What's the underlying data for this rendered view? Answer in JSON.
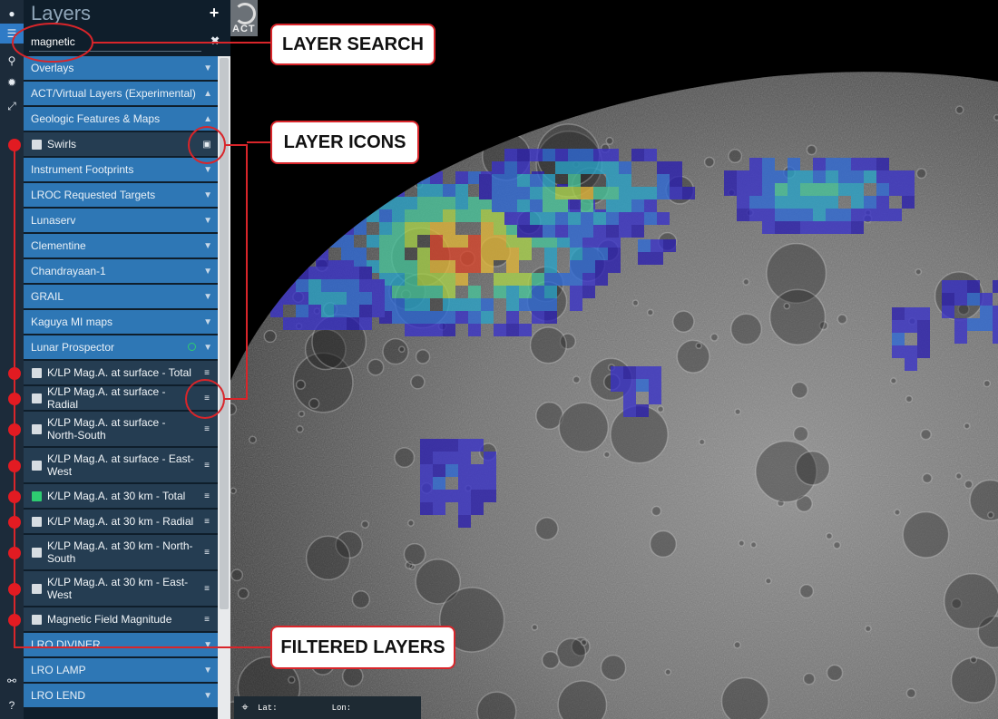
{
  "toolbar": {
    "tools": [
      {
        "name": "globe-icon",
        "glyph": "●",
        "active": false
      },
      {
        "name": "layers-menu-icon",
        "glyph": "☰",
        "active": true
      },
      {
        "name": "zoom-search-icon",
        "glyph": "⚲",
        "active": false
      },
      {
        "name": "settings-gear-icon",
        "glyph": "✹",
        "active": false
      },
      {
        "name": "expand-icon",
        "glyph": "⤢",
        "active": false
      },
      {
        "name": "link-icon",
        "glyph": "⚯",
        "active": false
      },
      {
        "name": "help-icon",
        "glyph": "?",
        "active": false
      }
    ]
  },
  "panel": {
    "title": "Layers",
    "add_glyph": "+",
    "search": {
      "value": "magnetic",
      "clear_glyph": "✖"
    }
  },
  "layers": [
    {
      "kind": "group",
      "label": "Overlays"
    },
    {
      "kind": "group",
      "label": "ACT/Virtual Layers (Experimental)",
      "open": true
    },
    {
      "kind": "group",
      "label": "Geologic Features & Maps",
      "open": true
    },
    {
      "kind": "layer",
      "label": "Swirls",
      "checked": false,
      "icon": "image-icon",
      "marked": true
    },
    {
      "kind": "group",
      "label": "Instrument Footprints"
    },
    {
      "kind": "group",
      "label": "LROC Requested Targets"
    },
    {
      "kind": "group",
      "label": "Lunaserv"
    },
    {
      "kind": "group",
      "label": "Clementine"
    },
    {
      "kind": "group",
      "label": "Chandrayaan-1"
    },
    {
      "kind": "group",
      "label": "GRAIL"
    },
    {
      "kind": "group",
      "label": "Kaguya MI maps"
    },
    {
      "kind": "group",
      "label": "Lunar Prospector",
      "loading": true
    },
    {
      "kind": "layer",
      "label": "K/LP Mag.A. at surface - Total",
      "checked": false,
      "icon": "sliders-icon",
      "marked": true
    },
    {
      "kind": "layer",
      "label": "K/LP Mag.A. at surface - Radial",
      "checked": false,
      "icon": "sliders-icon",
      "marked": true
    },
    {
      "kind": "layer",
      "label": "K/LP Mag.A. at surface - North-South",
      "checked": false,
      "icon": "sliders-icon",
      "marked": true,
      "tall": true
    },
    {
      "kind": "layer",
      "label": "K/LP Mag.A. at surface - East-West",
      "checked": false,
      "icon": "sliders-icon",
      "marked": true,
      "tall": true
    },
    {
      "kind": "layer",
      "label": "K/LP Mag.A. at 30 km - Total",
      "checked": true,
      "icon": "sliders-icon",
      "marked": true
    },
    {
      "kind": "layer",
      "label": "K/LP Mag.A. at 30 km - Radial",
      "checked": false,
      "icon": "sliders-icon",
      "marked": true
    },
    {
      "kind": "layer",
      "label": "K/LP Mag.A. at 30 km - North-South",
      "checked": false,
      "icon": "sliders-icon",
      "marked": true,
      "tall": true
    },
    {
      "kind": "layer",
      "label": "K/LP Mag.A. at 30 km - East-West",
      "checked": false,
      "icon": "sliders-icon",
      "marked": true,
      "tall": true
    },
    {
      "kind": "layer",
      "label": "Magnetic Field Magnitude",
      "checked": false,
      "icon": "sliders-icon",
      "marked": true
    },
    {
      "kind": "group",
      "label": "LRO DIVINER"
    },
    {
      "kind": "group",
      "label": "LRO LAMP"
    },
    {
      "kind": "group",
      "label": "LRO LEND"
    }
  ],
  "map": {
    "logo_text": "ACT",
    "lat_label": "Lat:",
    "lon_label": "Lon:"
  },
  "annotations": {
    "layer_search": "LAYER SEARCH",
    "layer_icons": "LAYER ICONS",
    "filtered_layers": "FILTERED LAYERS",
    "accent": "#d9252a"
  },
  "colors": {
    "group_row": "#2e77b5",
    "layer_row": "#253d52",
    "panel_bg": "#0f1e2b",
    "toolbar_bg": "#1c2b3a",
    "checked": "#2ecc71"
  }
}
